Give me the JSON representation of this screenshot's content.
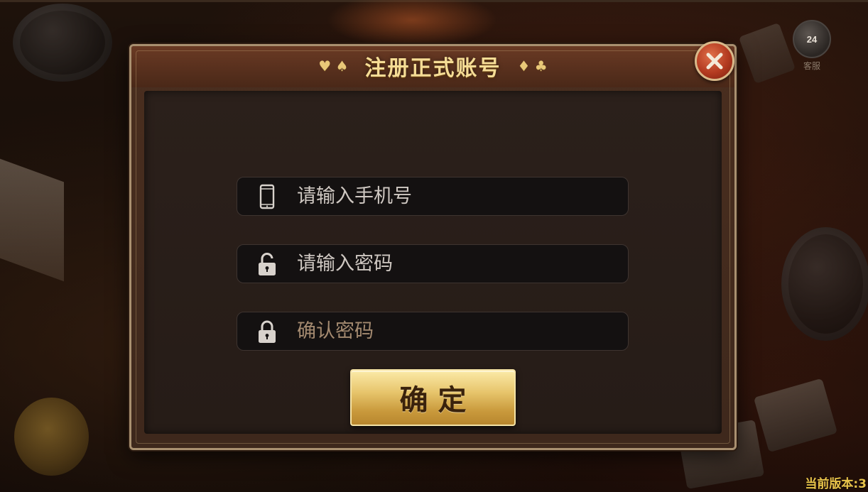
{
  "dialog": {
    "title": "注册正式账号",
    "title_left_suits": "♥ ♠",
    "title_right_suits": "♦ ♣"
  },
  "fields": {
    "phone": {
      "placeholder": "请输入手机号",
      "value": "",
      "icon": "mobile-phone-icon"
    },
    "password": {
      "placeholder": "请输入密码",
      "value": "",
      "icon": "unlocked-padlock-icon"
    },
    "confirm_password": {
      "placeholder": "确认密码",
      "value": "",
      "icon": "locked-padlock-icon"
    }
  },
  "buttons": {
    "confirm_label": "确定",
    "close_icon": "close-x-icon"
  },
  "badge": {
    "number": "24",
    "label": "客服"
  },
  "footer": {
    "version": "当前版本:3"
  },
  "colors": {
    "title_gold": "#f5dc95",
    "button_gold": "#e7c56c",
    "close_red": "#b33a20",
    "version_yellow": "#e8c34a"
  }
}
